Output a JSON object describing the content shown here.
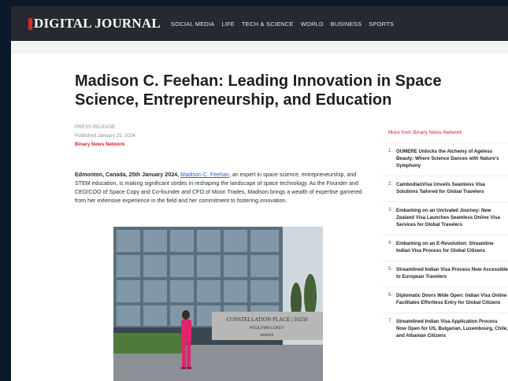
{
  "header": {
    "logo": "DIGITAL JOURNAL",
    "nav": [
      "SOCIAL MEDIA",
      "LIFE",
      "TECH & SCIENCE",
      "WORLD",
      "BUSINESS",
      "SPORTS"
    ]
  },
  "article": {
    "title": "Madison C. Feehan: Leading Innovation in Space Science, Entrepreneurship, and Education",
    "type": "PRESS RELEASE",
    "published": "Published January 25, 2024",
    "author": "Binary News Network",
    "lead_bold": "Edmonton, Canada, 25th January 2024,",
    "lead_link": "Madison C. Feehan",
    "body": ", an expert in space science, entrepreneurship, and STEM education, is making significant strides in reshaping the landscape of space technology. As the Founder and CEO/COO of Space Copy and Co-founder and CFO of Moon Trades, Madison brings a wealth of expertise garnered from her extensive experience in the field and her commitment to fostering innovation.",
    "photo": {
      "sign_line1": "CONSTELLATION PLACE | 10250",
      "sign_line2": "HOULIHAN LOKEY",
      "sign_line3": "wework"
    }
  },
  "sidebar": {
    "heading": "More from Binary News Network",
    "items": [
      {
        "num": "1.",
        "text": "OUMERE Unlocks the Alchemy of Ageless Beauty: Where Science Dances with Nature's Symphony"
      },
      {
        "num": "2.",
        "text": "CambodianVisa Unveils Seamless Visa Solutions Tailored for Global Travelers"
      },
      {
        "num": "3.",
        "text": "Embarking on an Unrivaled Journey: New Zealand Visa Launches Seamless Online Visa Services for Global Travelers"
      },
      {
        "num": "4.",
        "text": "Embarking on an E-Revolution: Streamline Indian Visa Process for Global Citizens"
      },
      {
        "num": "5.",
        "text": "Streamlined Indian Visa Process Now Accessible to European Travelers"
      },
      {
        "num": "6.",
        "text": "Diplomatic Doors Wide Open: Indian Visa Online Facilitates Effortless Entry for Global Citizens"
      },
      {
        "num": "7.",
        "text": "Streamlined Indian Visa Application Process Now Open for US, Bulgarian, Luxembourg, Chile, and Albanian Citizens"
      }
    ]
  }
}
